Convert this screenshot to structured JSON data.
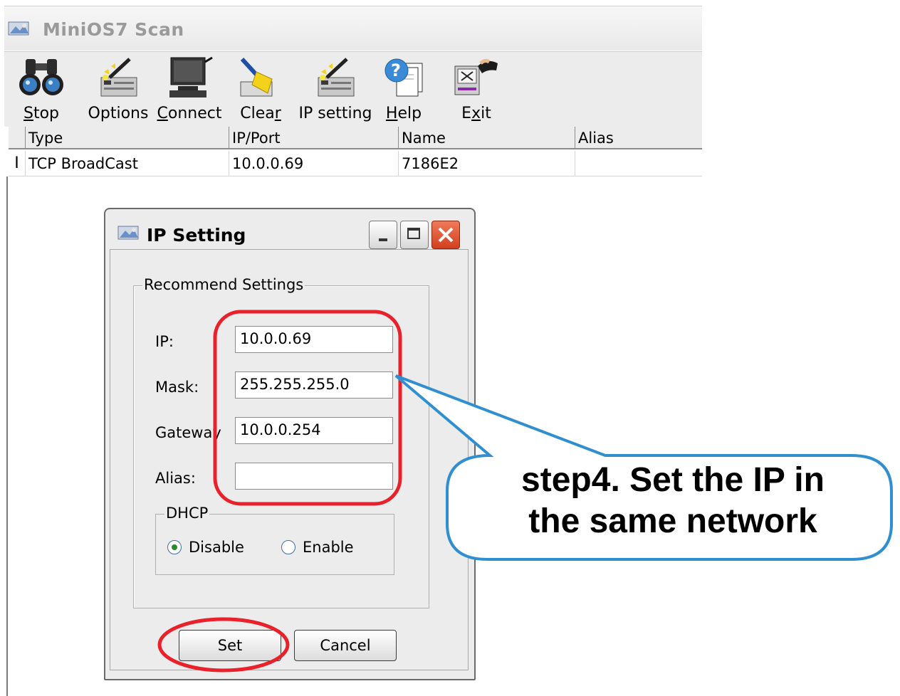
{
  "window": {
    "title": "MiniOS7 Scan",
    "icon": "scan-app-icon"
  },
  "toolbar": {
    "buttons": [
      {
        "label_pre": "",
        "label_key": "S",
        "label_post": "top",
        "icon": "binoculars-icon"
      },
      {
        "label_pre": "Options",
        "label_key": "",
        "label_post": "",
        "icon": "options-wand-icon"
      },
      {
        "label_pre": "",
        "label_key": "C",
        "label_post": "onnect",
        "icon": "connect-computer-icon"
      },
      {
        "label_pre": "Clea",
        "label_key": "r",
        "label_post": "",
        "icon": "clear-broom-icon"
      },
      {
        "label_pre": "IP setting",
        "label_key": "",
        "label_post": "",
        "icon": "ip-setting-wand-icon"
      },
      {
        "label_pre": "",
        "label_key": "H",
        "label_post": "elp",
        "icon": "help-icon"
      },
      {
        "label_pre": "E",
        "label_key": "x",
        "label_post": "it",
        "icon": "exit-icon"
      }
    ]
  },
  "grid": {
    "columns": [
      "Type",
      "IP/Port",
      "Name",
      "Alias"
    ],
    "rows": [
      {
        "type": "TCP BroadCast",
        "ip_port": "10.0.0.69",
        "name": "7186E2",
        "alias": ""
      }
    ]
  },
  "dialog": {
    "title": "IP Setting",
    "group_label": "Recommend Settings",
    "fields": {
      "ip_label": "IP:",
      "ip_value": "10.0.0.69",
      "mask_label": "Mask:",
      "mask_value": "255.255.255.0",
      "gateway_label": "Gateway",
      "gateway_value": "10.0.0.254",
      "alias_label": "Alias:",
      "alias_value": ""
    },
    "dhcp": {
      "label": "DHCP",
      "disable_label": "Disable",
      "enable_label": "Enable",
      "selected": "Disable"
    },
    "set_label": "Set",
    "cancel_label": "Cancel"
  },
  "annotation": {
    "line1": "step4. Set the IP in",
    "line2": "the same network",
    "highlight_color": "#e8212b",
    "callout_border_color": "#2f8fd0"
  }
}
